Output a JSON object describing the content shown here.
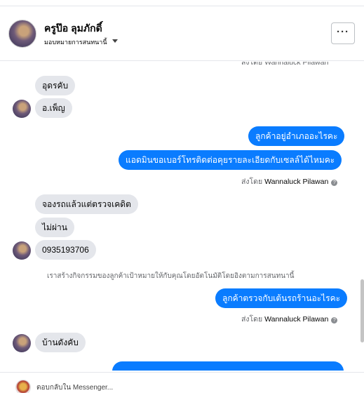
{
  "header": {
    "name": "ครูป๊อ ลุมภักดิ์",
    "assign_label": "มอบหมายการสนทนานี้",
    "more_label": "···"
  },
  "thread": {
    "cutoff_top": "ส่งโดย Wannaluck Pilawan",
    "messages": [
      {
        "text": "อุดรคับ"
      },
      {
        "text": "อ.เพ็ญ"
      },
      {
        "text": "ลูกค้าอยู่อำเภออะไรคะ"
      },
      {
        "text": "แอดมินขอเบอร์โทรติดต่อคุยรายละเอียดกับเซลล์ได้ไหมคะ"
      },
      {
        "text": "จองรถแล้วแต่ตรวจเคดิต"
      },
      {
        "text": "ไม่ผ่าน"
      },
      {
        "text": "0935193706"
      },
      {
        "text": "ลูกค้าตรวจกับเต้นรถร้านอะไรคะ"
      },
      {
        "text": "บ้านดังคับ"
      }
    ],
    "sent_by_prefix": "ส่งโดย",
    "sent_by_name": "Wannaluck Pilawan",
    "system_note": "เราสร้างกิจกรรมของลูกค้าเป้าหมายให้กับคุณโดยอัตโนมัติโดยอิงตามการสนทนานี้"
  },
  "composer": {
    "placeholder": "ตอบกลับใน Messenger..."
  },
  "colors": {
    "outgoing": "#0a7cff",
    "incoming": "#e4e6eb"
  }
}
